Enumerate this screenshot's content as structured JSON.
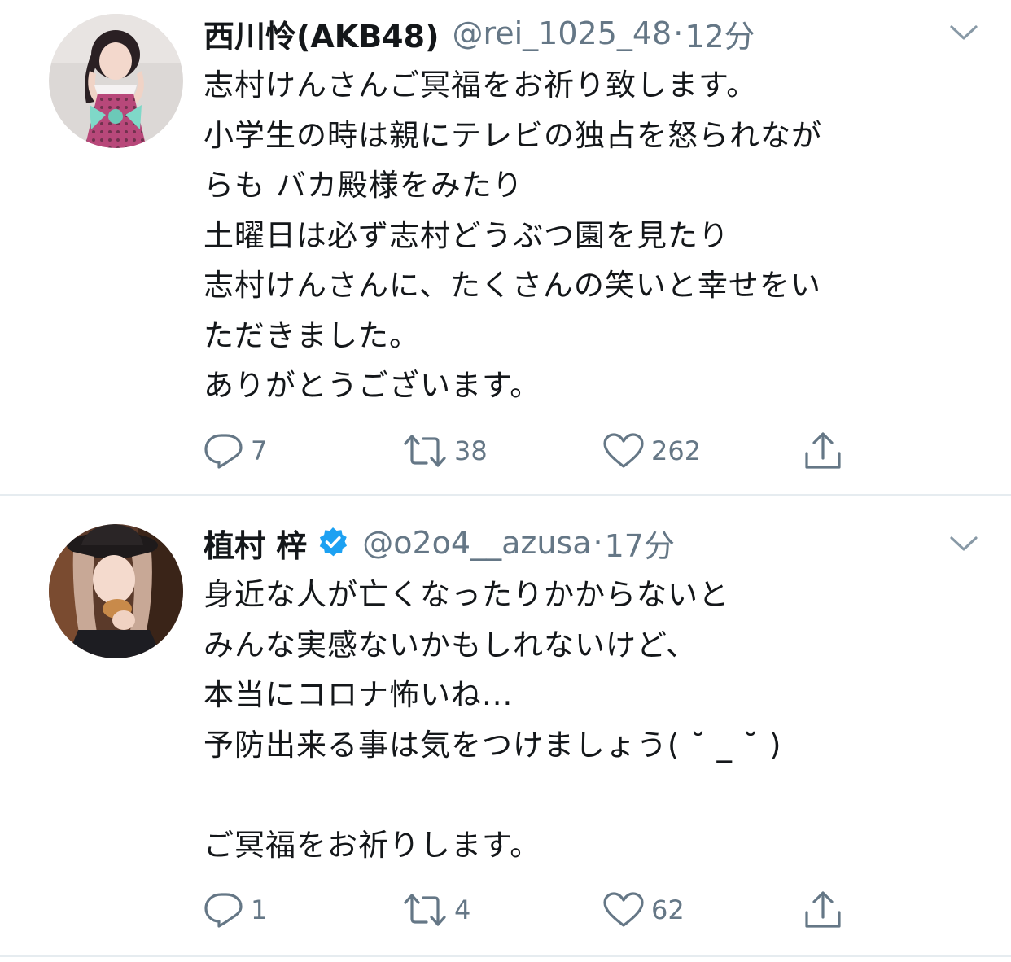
{
  "tweets": [
    {
      "display_name": "西川怜(AKB48)",
      "handle": "@rei_1025_48",
      "separator": "·",
      "time": "12分",
      "verified": false,
      "lines": [
        "志村けんさんご冥福をお祈り致します。",
        "小学生の時は親にテレビの独占を怒られなが",
        "らも バカ殿様をみたり",
        "土曜日は必ず志村どうぶつ園を見たり",
        "志村けんさんに、たくさんの笑いと幸せをい",
        "ただきました。",
        "ありがとうございます。"
      ],
      "replies": "7",
      "retweets": "38",
      "likes": "262"
    },
    {
      "display_name": "植村 梓",
      "handle": "@o2o4__azusa",
      "separator": "·",
      "time": "17分",
      "verified": true,
      "lines": [
        "身近な人が亡くなったりかからないと",
        "みんな実感ないかもしれないけど、",
        "本当にコロナ怖いね...",
        "予防出来る事は気をつけましょう( ˘ _ ˘ )",
        "",
        "ご冥福をお祈りします。"
      ],
      "replies": "1",
      "retweets": "4",
      "likes": "62"
    }
  ],
  "icons": {
    "reply": "speech-bubble-icon",
    "retweet": "retweet-arrows-icon",
    "like": "heart-outline-icon",
    "share": "share-upload-icon",
    "more": "chevron-down-icon",
    "verified": "verified-badge-icon"
  },
  "colors": {
    "text_primary": "#14171a",
    "text_secondary": "#657786",
    "verified_blue": "#1da1f2",
    "divider": "#e6ecf0",
    "background": "#ffffff"
  }
}
